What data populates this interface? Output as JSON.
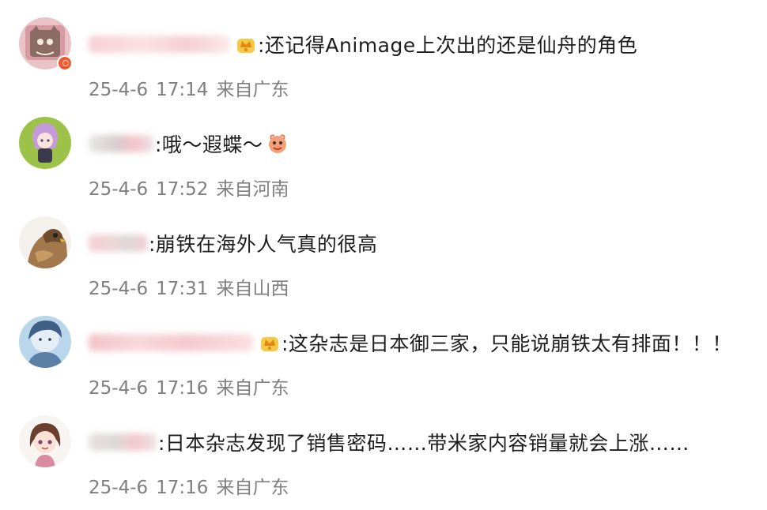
{
  "comments": [
    {
      "text": ":还记得Animage上次出的还是仙舟的角色",
      "date": "25-4-6",
      "time": "17:14",
      "location": "来自广东",
      "has_badge": true,
      "has_vip_dot": true,
      "avatar_icon": "cat-avatar-icon"
    },
    {
      "text": ":哦～遐蝶～",
      "date": "25-4-6",
      "time": "17:52",
      "location": "来自河南",
      "has_badge": false,
      "has_sticker": true,
      "avatar_icon": "anime-girl-avatar-icon"
    },
    {
      "text": ":崩铁在海外人气真的很高",
      "date": "25-4-6",
      "time": "17:31",
      "location": "来自山西",
      "has_badge": false,
      "avatar_icon": "falcon-avatar-icon"
    },
    {
      "text": ":这杂志是日本御三家，只能说崩铁太有排面！！！",
      "date": "25-4-6",
      "time": "17:16",
      "location": "来自广东",
      "has_badge": true,
      "avatar_icon": "blue-character-avatar-icon"
    },
    {
      "text": ":日本杂志发现了销售密码……带米家内容销量就会上涨……",
      "date": "25-4-6",
      "time": "17:16",
      "location": "来自广东",
      "has_badge": false,
      "avatar_icon": "chibi-girl-avatar-icon"
    }
  ],
  "colors": {
    "text": "#1e1e1e",
    "meta": "#7f7f7f",
    "badge": "#f5a623",
    "vip": "#f0582e"
  }
}
